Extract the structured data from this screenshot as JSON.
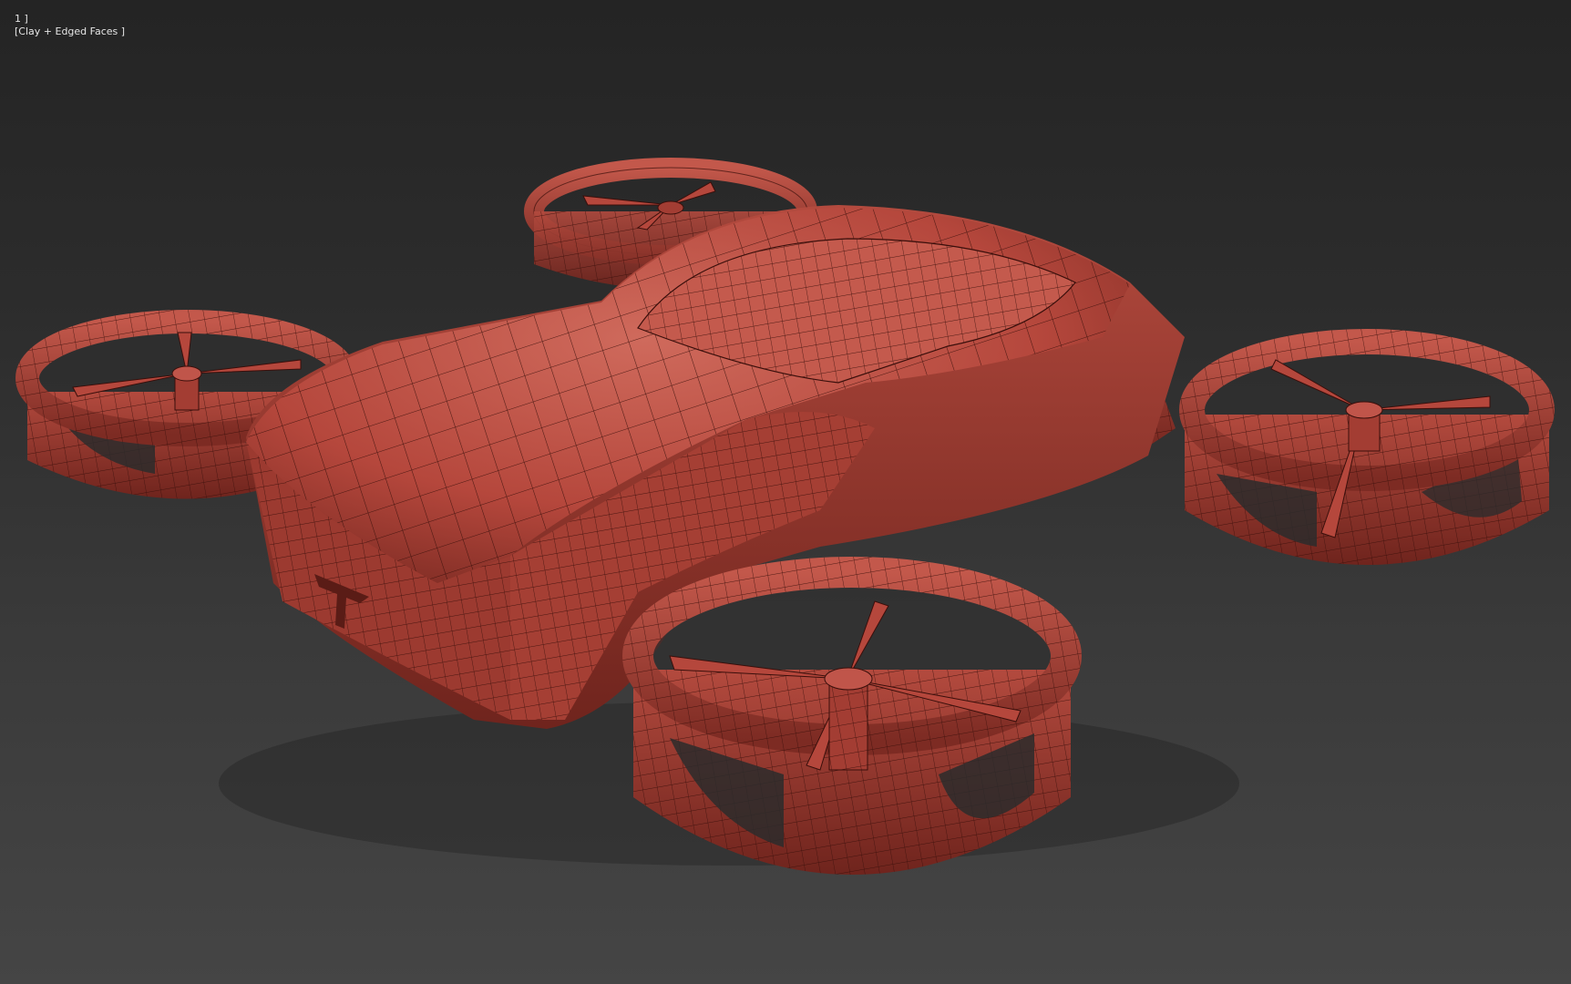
{
  "viewport": {
    "label_prefix": "1 ]",
    "label_shading": "[Clay + Edged Faces ]",
    "background_top": "#242424",
    "background_bottom": "#454545"
  },
  "model": {
    "clay_color": "#b5473c",
    "clay_dark": "#7a2a22",
    "clay_light": "#cf6a5c",
    "edge_color": "#3a0f0b"
  }
}
